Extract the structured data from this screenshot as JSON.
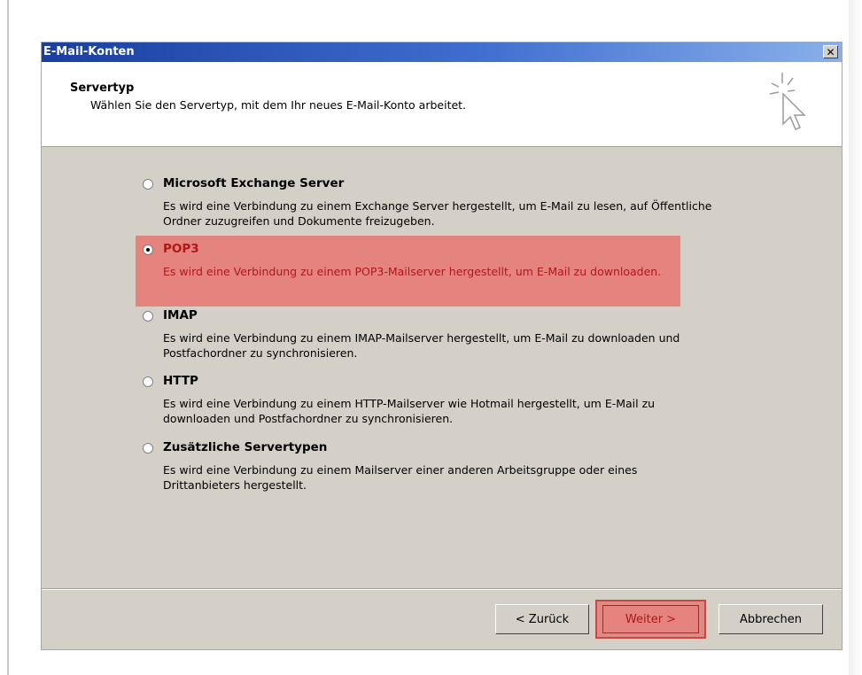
{
  "window": {
    "title": "E-Mail-Konten",
    "close_glyph": "✕"
  },
  "header": {
    "title": "Servertyp",
    "subtitle": "Wählen Sie den Servertyp, mit dem Ihr neues E-Mail-Konto arbeitet.",
    "icon": "cursor-sparkle-icon"
  },
  "options": [
    {
      "label": "Microsoft Exchange Server",
      "description": "Es wird eine Verbindung zu einem Exchange Server hergestellt, um E-Mail zu lesen, auf Öffentliche Ordner zuzugreifen und Dokumente freizugeben.",
      "selected": false
    },
    {
      "label": "POP3",
      "description": "Es wird eine Verbindung zu einem POP3-Mailserver hergestellt, um E-Mail zu downloaden.",
      "selected": true
    },
    {
      "label": "IMAP",
      "description": "Es wird eine Verbindung zu einem IMAP-Mailserver hergestellt, um E-Mail zu downloaden und Postfachordner zu synchronisieren.",
      "selected": false
    },
    {
      "label": "HTTP",
      "description": "Es wird eine Verbindung zu einem HTTP-Mailserver wie Hotmail hergestellt, um E-Mail zu downloaden und Postfachordner zu synchronisieren.",
      "selected": false
    },
    {
      "label": "Zusätzliche Servertypen",
      "description": "Es wird eine Verbindung zu einem Mailserver einer anderen Arbeitsgruppe oder eines Drittanbieters hergestellt.",
      "selected": false
    }
  ],
  "buttons": {
    "back": "< Zurück",
    "next": "Weiter >",
    "cancel": "Abbrechen"
  },
  "colors": {
    "highlight": "#e5837f",
    "highlight_text": "#b01818",
    "titlebar": "#1a3fa0",
    "dialog_bg": "#d4d0c8"
  }
}
